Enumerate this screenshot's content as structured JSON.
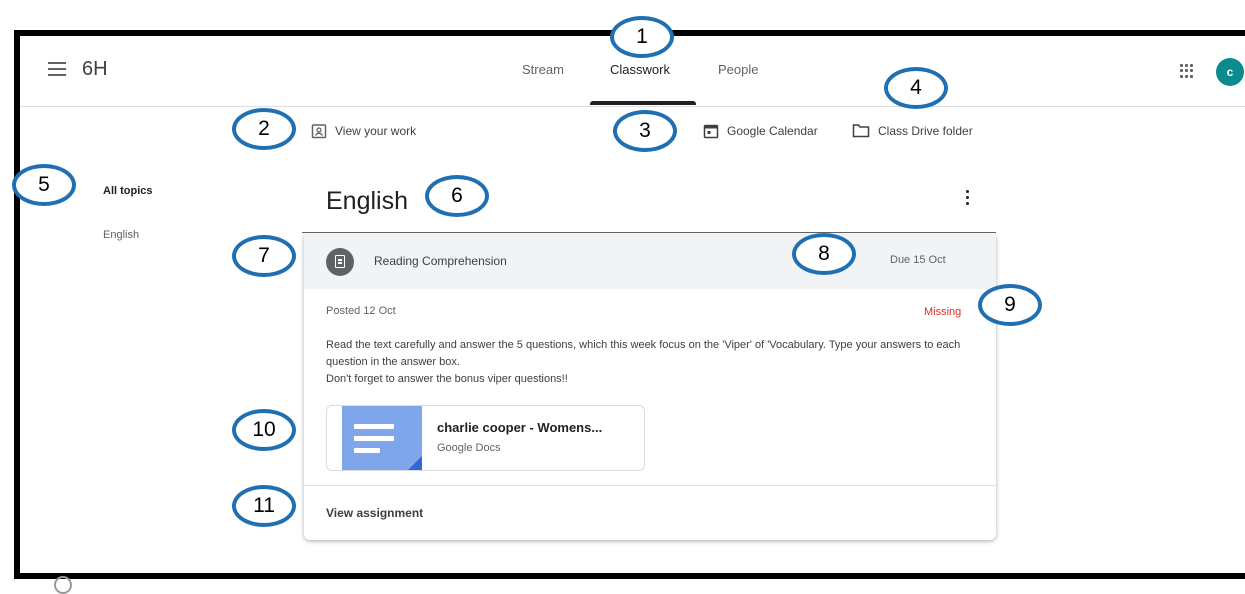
{
  "header": {
    "class_name": "6H",
    "tabs": [
      {
        "label": "Stream"
      },
      {
        "label": "Classwork"
      },
      {
        "label": "People"
      }
    ],
    "avatar_initial": "c"
  },
  "links": {
    "view_work": "View your work",
    "calendar": "Google Calendar",
    "drive": "Class Drive folder"
  },
  "topics": {
    "all": "All topics",
    "items": [
      "English"
    ]
  },
  "section": {
    "title": "English"
  },
  "assignment": {
    "title": "Reading Comprehension",
    "due": "Due 15 Oct",
    "posted": "Posted 12 Oct",
    "status": "Missing",
    "description_lines": [
      "Read the text carefully and answer the 5 questions, which this week focus on the 'Viper' of 'Vocabulary.  Type your answers to each question in the answer box.",
      "Don't forget to answer the bonus viper questions!!"
    ],
    "attachment": {
      "title": "charlie cooper - Womens...",
      "type": "Google Docs"
    },
    "view_label": "View assignment"
  },
  "callouts": [
    "1",
    "2",
    "3",
    "4",
    "5",
    "6",
    "7",
    "8",
    "9",
    "10",
    "11"
  ],
  "colors": {
    "accent": "#1f6fb2",
    "missing": "#d93025",
    "avatar": "#0b8a8f",
    "doc_thumb": "#7fa6eb"
  }
}
